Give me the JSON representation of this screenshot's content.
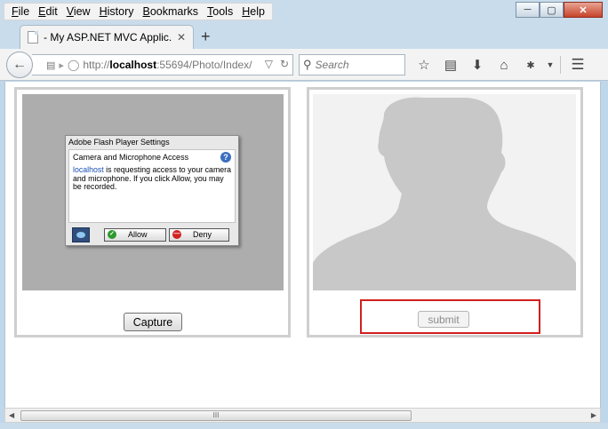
{
  "menu": {
    "items": [
      {
        "label": "File",
        "accel": "F",
        "rest": "ile"
      },
      {
        "label": "Edit",
        "accel": "E",
        "rest": "dit"
      },
      {
        "label": "View",
        "accel": "V",
        "rest": "iew"
      },
      {
        "label": "History",
        "accel": "H",
        "rest": "istory"
      },
      {
        "label": "Bookmarks",
        "accel": "B",
        "rest": "ookmarks"
      },
      {
        "label": "Tools",
        "accel": "T",
        "rest": "ools"
      },
      {
        "label": "Help",
        "accel": "H",
        "rest": "elp"
      }
    ]
  },
  "tab": {
    "title": "- My ASP.NET MVC Applic...",
    "close": "✕",
    "new_tab": "+"
  },
  "nav": {
    "url_prefix": "http://",
    "url_host": "localhost",
    "url_rest": ":55694/Photo/Index/",
    "search_placeholder": "Search"
  },
  "flash": {
    "title": "Adobe Flash Player Settings",
    "heading": "Camera and Microphone Access",
    "help": "?",
    "link": "localhost",
    "message": " is requesting access to your camera and microphone. If you click Allow, you may be recorded.",
    "allow": "Allow",
    "deny": "Deny"
  },
  "buttons": {
    "capture": "Capture",
    "submit": "submit"
  },
  "scroll": {
    "thumb_grip": "III"
  },
  "colors": {
    "highlight": "#d31f1f",
    "silhouette": "#c8c8c8"
  }
}
